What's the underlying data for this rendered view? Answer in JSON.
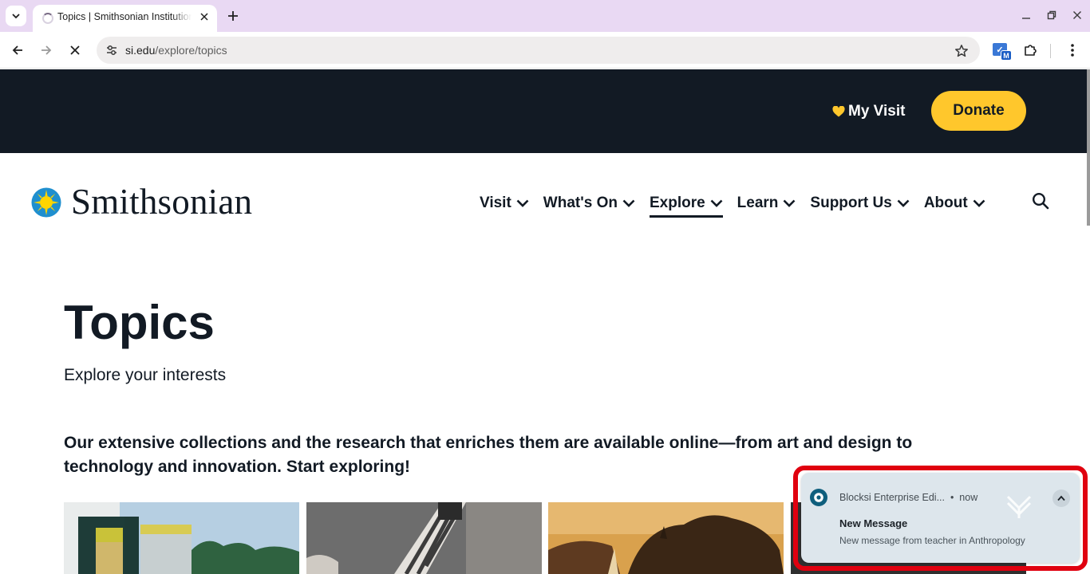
{
  "browser": {
    "tab_title": "Topics | Smithsonian Institution",
    "url_host": "si.edu",
    "url_path": "/explore/topics",
    "extension_badge": "M"
  },
  "site": {
    "utility": {
      "my_visit": "My Visit",
      "donate": "Donate"
    },
    "logo_text": "Smithsonian",
    "nav": [
      "Visit",
      "What's On",
      "Explore",
      "Learn",
      "Support Us",
      "About"
    ],
    "active_nav": "Explore"
  },
  "main": {
    "title": "Topics",
    "subtitle": "Explore your interests",
    "intro_line1": "Our extensive collections and the research that enriches them are available online—from art and design to",
    "intro_line2": "technology and innovation. Start exploring!"
  },
  "notification": {
    "app": "Blocksi Enterprise Edi...",
    "time": "now",
    "title": "New Message",
    "body": "New message from teacher in Anthropology"
  },
  "colors": {
    "utility_bar": "#121a24",
    "donate": "#ffc72c",
    "heart": "#ffc72c",
    "notification_highlight": "#e0000f"
  }
}
